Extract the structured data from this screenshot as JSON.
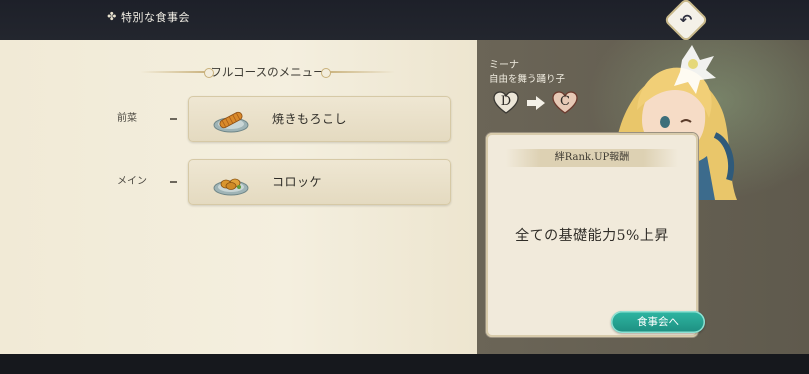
{
  "header": {
    "title": "特別な食事会",
    "title_icon": "flower-icon",
    "back_icon": "return-arrow-icon"
  },
  "menu": {
    "title": "フルコースのメニュー",
    "courses": [
      {
        "label": "前菜",
        "dish": "焼きもろこし",
        "dish_icon": "grilled-corn-icon"
      },
      {
        "label": "メイン",
        "dish": "コロッケ",
        "dish_icon": "croquette-icon"
      }
    ]
  },
  "character": {
    "name": "ミーナ",
    "subtitle": "自由を舞う踊り子",
    "rank_from": "D",
    "rank_to": "C"
  },
  "reward": {
    "header": "絆Rank.UP報酬",
    "text": "全ての基礎能力5%上昇"
  },
  "actions": {
    "dinner_button": "食事会へ"
  },
  "colors": {
    "accent_teal": "#25a596",
    "panel_cream": "#f1eadb",
    "gold_trim": "#c8b07a"
  }
}
